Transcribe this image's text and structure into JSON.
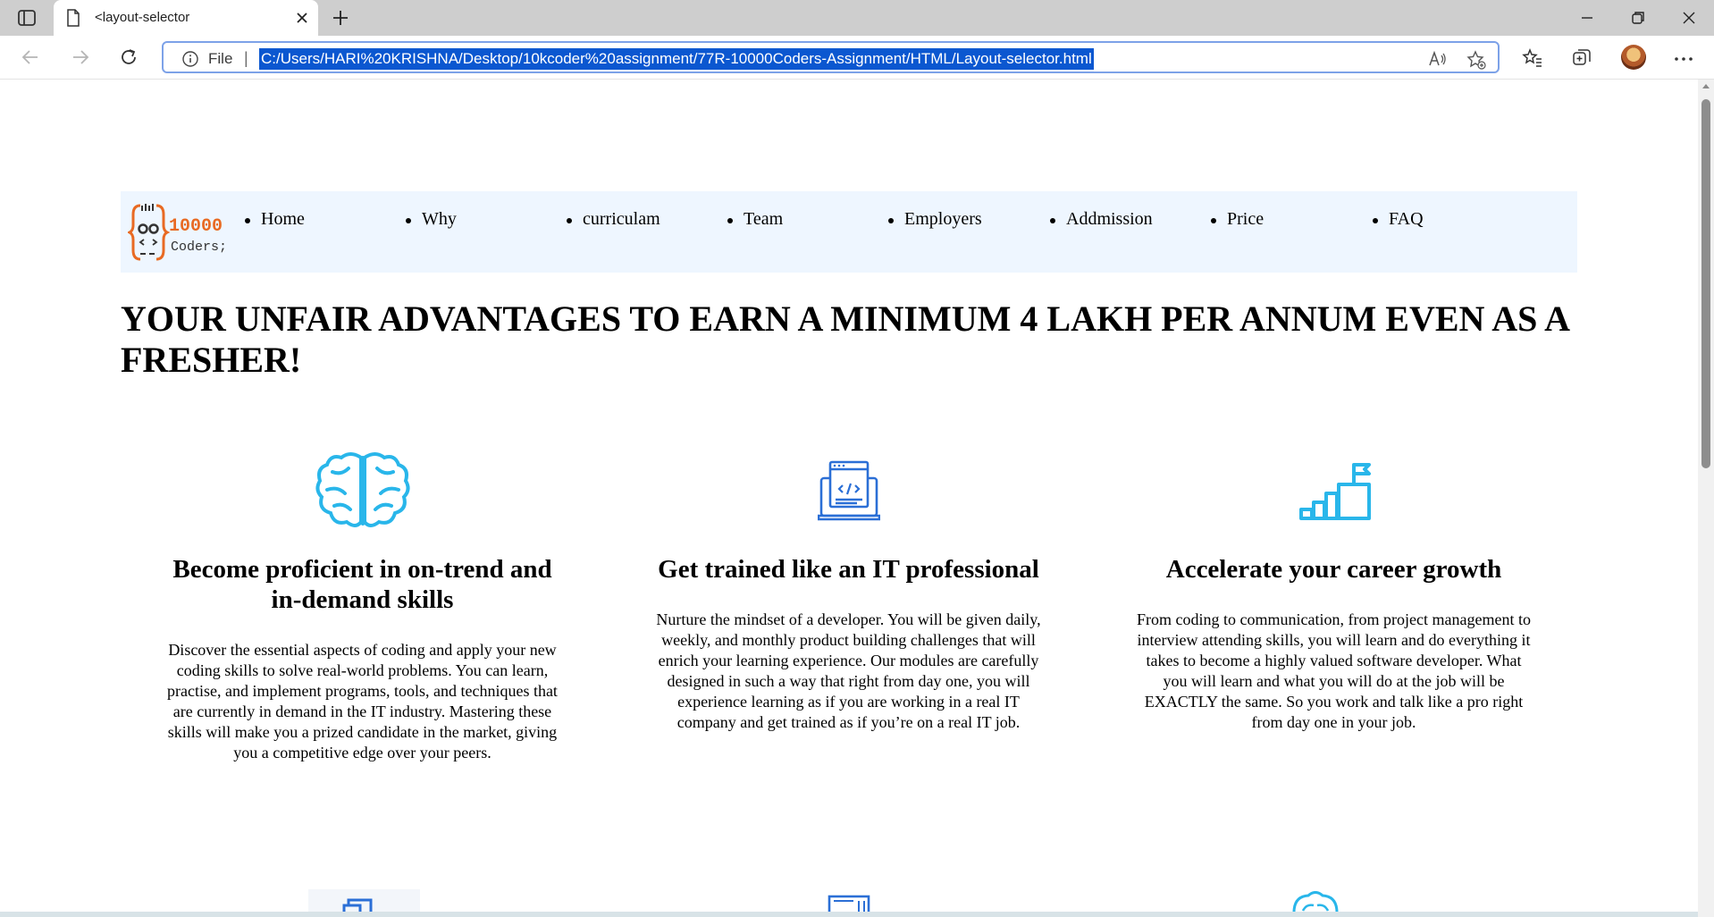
{
  "browser": {
    "tab_title": "<layout-selector",
    "address_prefix": "File",
    "address_separator": "|",
    "url": "C:/Users/HARI%20KRISHNA/Desktop/10kcoder%20assignment/77R-10000Coders-Assignment/HTML/Layout-selector.html"
  },
  "logo": {
    "number": "10000",
    "word": "Coders;"
  },
  "nav": {
    "items": [
      {
        "label": "Home"
      },
      {
        "label": "Why"
      },
      {
        "label": "curriculam"
      },
      {
        "label": "Team"
      },
      {
        "label": "Employers"
      },
      {
        "label": "Addmission"
      },
      {
        "label": "Price"
      },
      {
        "label": "FAQ"
      }
    ]
  },
  "headline": "YOUR UNFAIR ADVANTAGES TO EARN A MINIMUM 4 LAKH PER ANNUM EVEN AS A FRESHER!",
  "features": [
    {
      "icon": "brain-icon",
      "title": "Become proficient in on-trend and in-demand skills",
      "text": "Discover the essential aspects of coding and apply your new coding skills to solve real-world problems. You can learn, practise, and implement programs, tools, and techniques that are currently in demand in the IT industry. Mastering these skills will make you a prized candidate in the market, giving you a competitive edge over your peers."
    },
    {
      "icon": "laptop-code-icon",
      "title": "Get trained like an IT professional",
      "text": "Nurture the mindset of a developer. You will be given daily, weekly, and monthly product building challenges that will enrich your learning experience. Our modules are carefully designed in such a way that right from day one, you will experience learning as if you are working in a real IT company and get trained as if you’re on a real IT job."
    },
    {
      "icon": "growth-steps-icon",
      "title": "Accelerate your career growth",
      "text": "From coding to communication, from project management to interview attending skills, you will learn and do everything it takes to become a highly valued software developer. What you will learn and what you will do at the job will be EXACTLY the same. So you work and talk like a pro right from day one in your job."
    }
  ]
}
